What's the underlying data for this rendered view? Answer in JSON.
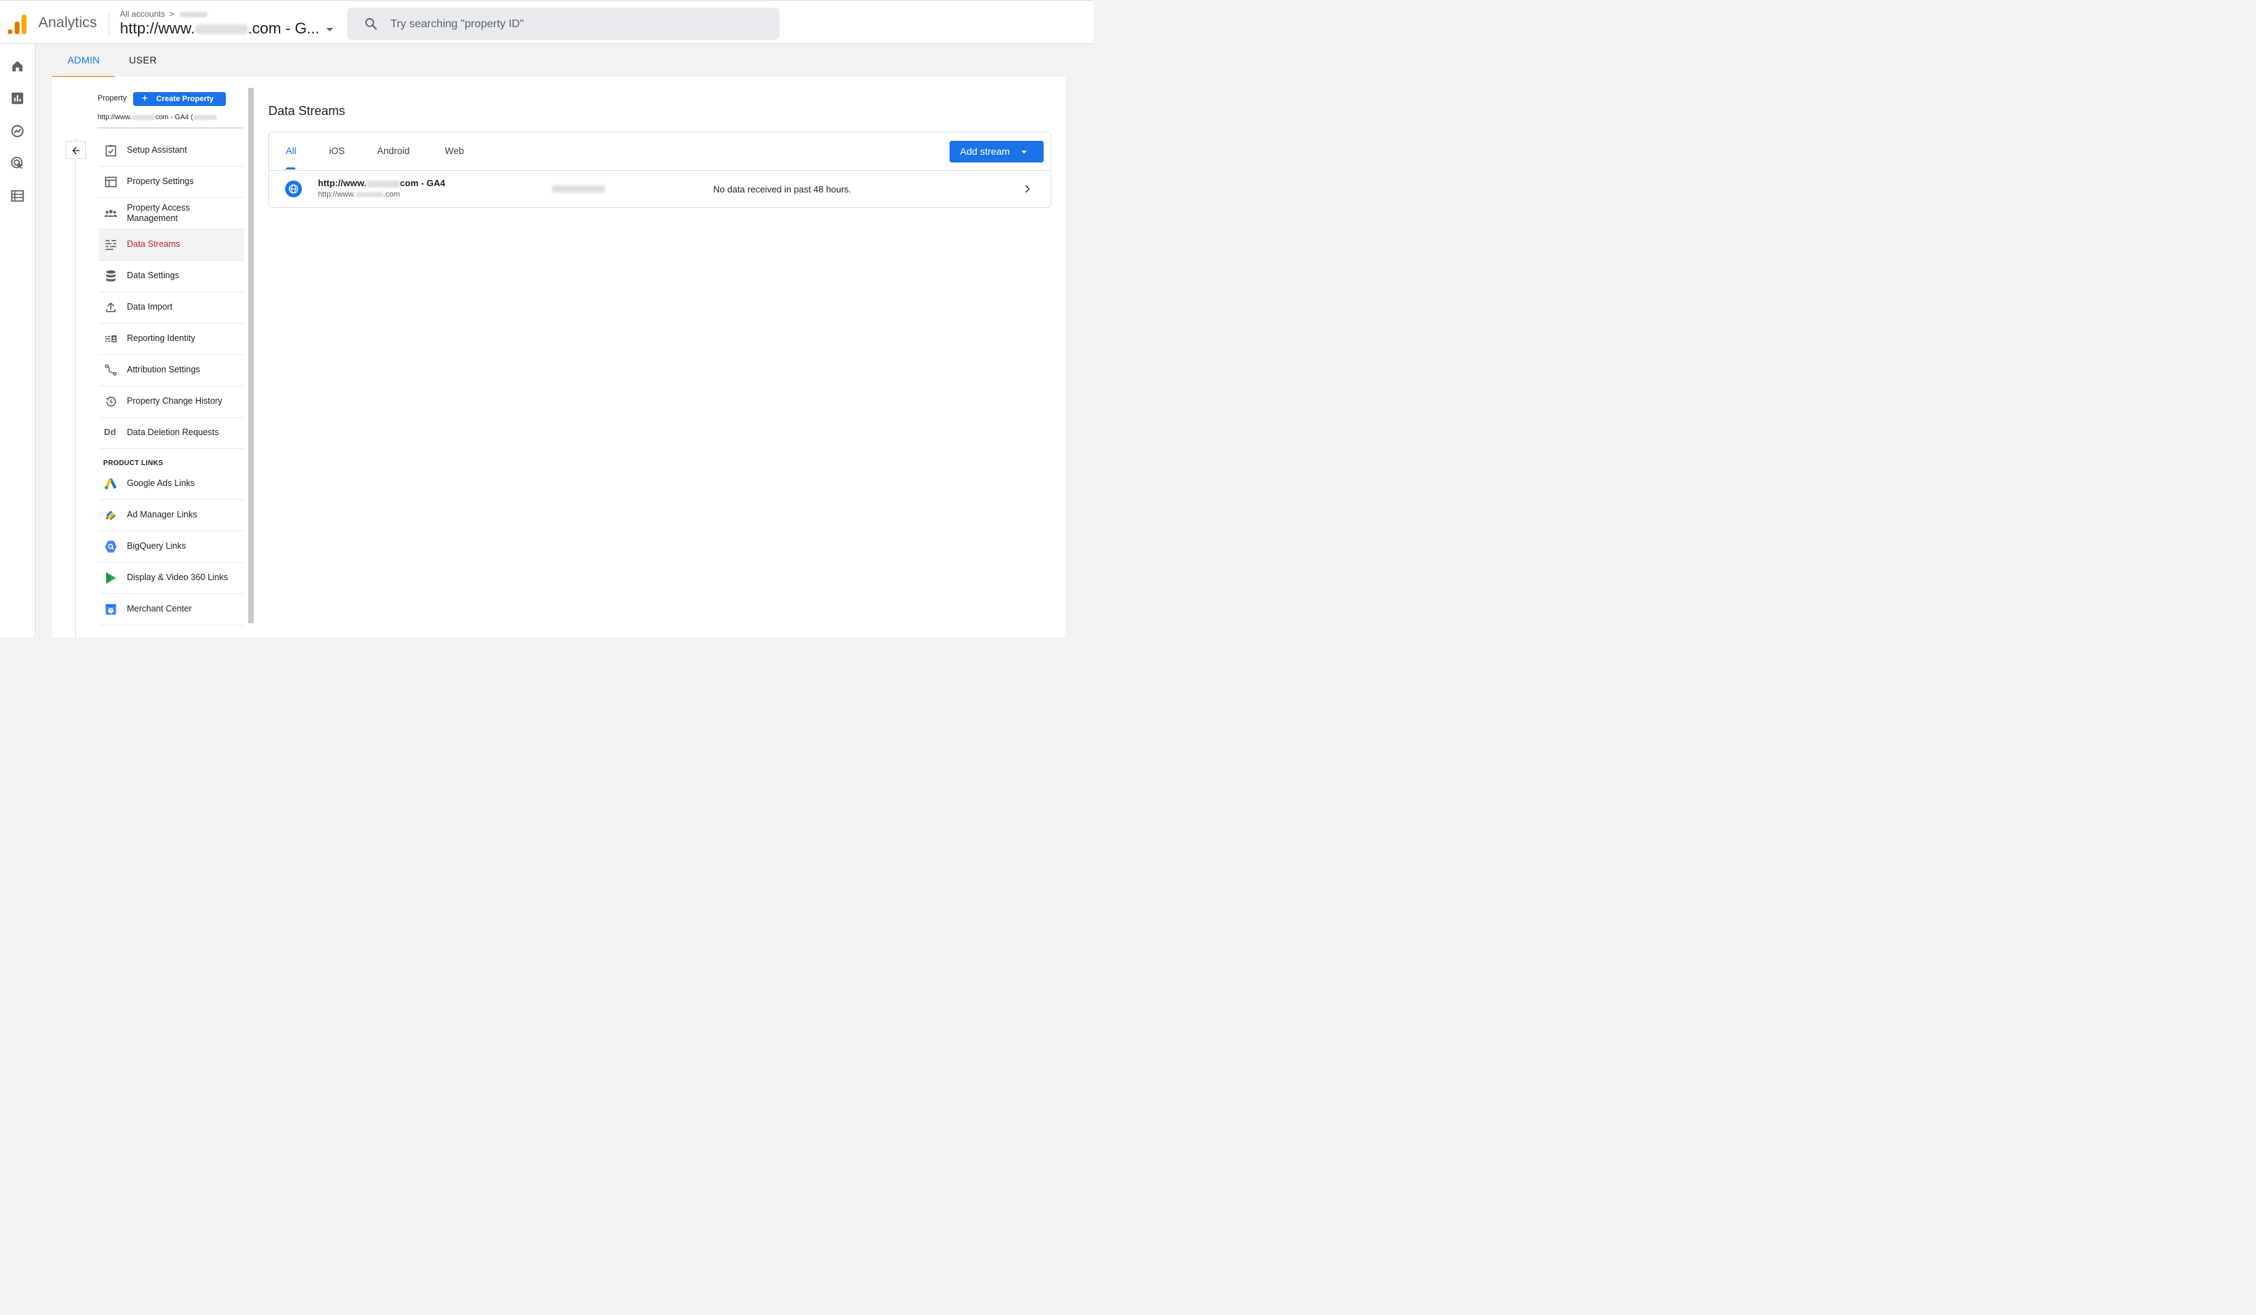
{
  "header": {
    "app_title": "Analytics",
    "breadcrumb_root": "All accounts",
    "breadcrumb_sep": ">",
    "property_prefix": "http://www.",
    "property_suffix": ".com - G...",
    "search_placeholder": "Try searching \"property ID\""
  },
  "rail": {
    "items": [
      {
        "name": "home-icon"
      },
      {
        "name": "reports-icon"
      },
      {
        "name": "explore-icon"
      },
      {
        "name": "advertising-icon"
      },
      {
        "name": "configure-icon"
      }
    ]
  },
  "admin_tabs": [
    {
      "label": "ADMIN",
      "active": true
    },
    {
      "label": "USER",
      "active": false
    }
  ],
  "property_column": {
    "label": "Property",
    "create_button": "Create Property",
    "selected_prefix": "http://www.",
    "selected_suffix": "com - GA4 ("
  },
  "nav": {
    "items": [
      {
        "label": "Setup Assistant",
        "icon": "clipboard-check-icon"
      },
      {
        "label": "Property Settings",
        "icon": "property-settings-icon"
      },
      {
        "label": "Property Access Management",
        "icon": "people-icon"
      },
      {
        "label": "Data Streams",
        "icon": "data-streams-icon",
        "selected": true
      },
      {
        "label": "Data Settings",
        "icon": "database-icon"
      },
      {
        "label": "Data Import",
        "icon": "upload-icon"
      },
      {
        "label": "Reporting Identity",
        "icon": "reporting-identity-icon"
      },
      {
        "label": "Attribution Settings",
        "icon": "attribution-icon"
      },
      {
        "label": "Property Change History",
        "icon": "history-icon"
      },
      {
        "label": "Data Deletion Requests",
        "icon": "data-deletion-icon",
        "icon_text": "Dd"
      }
    ],
    "section_label": "PRODUCT LINKS",
    "links": [
      {
        "label": "Google Ads Links",
        "icon": "google-ads-icon"
      },
      {
        "label": "Ad Manager Links",
        "icon": "ad-manager-icon"
      },
      {
        "label": "BigQuery Links",
        "icon": "bigquery-icon"
      },
      {
        "label": "Display & Video 360 Links",
        "icon": "display-video-360-icon"
      },
      {
        "label": "Merchant Center",
        "icon": "merchant-center-icon"
      }
    ]
  },
  "main": {
    "title": "Data Streams",
    "tabs": [
      {
        "label": "All",
        "active": true
      },
      {
        "label": "iOS"
      },
      {
        "label": "Android"
      },
      {
        "label": "Web"
      }
    ],
    "add_stream_label": "Add stream",
    "streams": [
      {
        "name_prefix": "http://www.",
        "name_suffix": "com - GA4",
        "url_prefix": "http://www.",
        "url_suffix": ".com",
        "status": "No data received in past 48 hours."
      }
    ]
  },
  "colors": {
    "accent_blue": "#1a73e8",
    "selected_red": "#c5221f",
    "tab_underline_orange": "#e37400",
    "logo_orange": "#e37400",
    "logo_yellow": "#f9ab00"
  }
}
